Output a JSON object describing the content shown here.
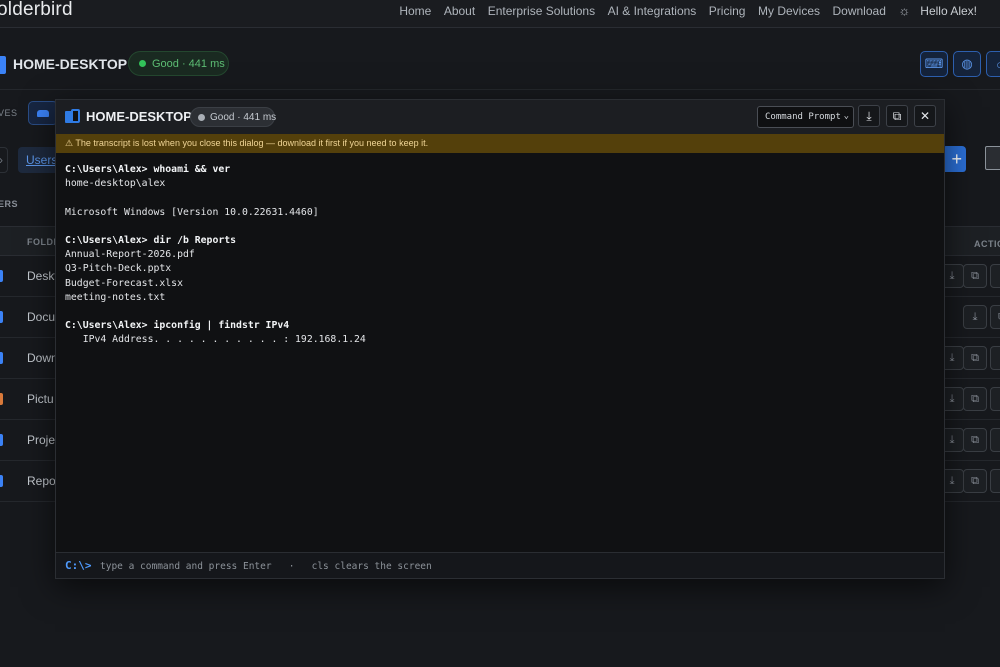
{
  "app": {
    "brand": "olderbird",
    "nav": [
      "Home",
      "About",
      "Enterprise Solutions",
      "AI & Integrations",
      "Pricing",
      "My Devices",
      "Download"
    ],
    "greeting": "Hello Alex!",
    "theme_icon": "sun-icon"
  },
  "device_bar": {
    "name": "HOME-DESKTOP",
    "status": "Good · 441 ms",
    "status_color": "#33c35a",
    "buttons": [
      "terminal-icon",
      "globe-icon",
      "search-icon"
    ]
  },
  "drives": {
    "label": "VES"
  },
  "breadcrumb": {
    "current": "Users"
  },
  "section": {
    "label": "ERS"
  },
  "table": {
    "col_folders": "FOLDE",
    "col_actions": "ACTIO",
    "rows": [
      {
        "name": "Deskt",
        "color": "#3b82f6"
      },
      {
        "name": "Docu",
        "color": "#3b82f6"
      },
      {
        "name": "Down",
        "color": "#3b82f6"
      },
      {
        "name": "Pictu",
        "color": "#d9793a"
      },
      {
        "name": "Proje",
        "color": "#3b82f6"
      },
      {
        "name": "Repo",
        "color": "#3b82f6"
      }
    ]
  },
  "dialog": {
    "title": "HOME-DESKTOP",
    "status": "Good · 441 ms",
    "shell": "Command Prompt",
    "warning": "⚠ The transcript is lost when you close this dialog — download it first if you need to keep it.",
    "transcript": [
      {
        "text": "C:\\Users\\Alex> whoami && ver",
        "type": "cmd"
      },
      {
        "text": "home-desktop\\alex",
        "type": "out"
      },
      {
        "text": "",
        "type": "out"
      },
      {
        "text": "Microsoft Windows [Version 10.0.22631.4460]",
        "type": "out"
      },
      {
        "text": "",
        "type": "out"
      },
      {
        "text": "C:\\Users\\Alex> dir /b Reports",
        "type": "cmd"
      },
      {
        "text": "Annual-Report-2026.pdf",
        "type": "out"
      },
      {
        "text": "Q3-Pitch-Deck.pptx",
        "type": "out"
      },
      {
        "text": "Budget-Forecast.xlsx",
        "type": "out"
      },
      {
        "text": "meeting-notes.txt",
        "type": "out"
      },
      {
        "text": "",
        "type": "out"
      },
      {
        "text": "C:\\Users\\Alex> ipconfig | findstr IPv4",
        "type": "cmd"
      },
      {
        "text": "   IPv4 Address. . . . . . . . . . . : 192.168.1.24",
        "type": "out"
      }
    ],
    "prompt": "C:\\>",
    "input_value": "",
    "input_placeholder": "type a command and press Enter   ·   cls clears the screen"
  }
}
